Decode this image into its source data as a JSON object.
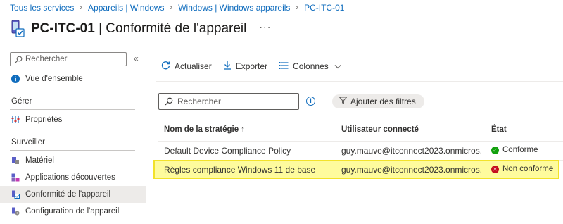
{
  "breadcrumb": [
    "Tous les services",
    "Appareils | Windows",
    "Windows | Windows appareils",
    "PC-ITC-01"
  ],
  "header": {
    "device": "PC-ITC-01",
    "separator": "|",
    "subtitle": "Conformité de l'appareil",
    "more": "···"
  },
  "sidebar": {
    "search_placeholder": "Rechercher",
    "collapse": "«",
    "overview": "Vue d'ensemble",
    "section_manage": "Gérer",
    "properties": "Propriétés",
    "section_monitor": "Surveiller",
    "items": [
      "Matériel",
      "Applications découvertes",
      "Conformité de l'appareil",
      "Configuration de l'appareil"
    ]
  },
  "toolbar": {
    "refresh": "Actualiser",
    "export": "Exporter",
    "columns": "Colonnes"
  },
  "filters": {
    "search_placeholder": "Rechercher",
    "add_filters": "Ajouter des filtres"
  },
  "table": {
    "headers": [
      "Nom de la stratégie ↑",
      "Utilisateur connecté",
      "État"
    ],
    "rows": [
      {
        "policy": "Default Device Compliance Policy",
        "user": "guy.mauve@itconnect2023.onmicros...",
        "state": "Conforme"
      },
      {
        "policy": "Règles compliance Windows 11 de base",
        "user": "guy.mauve@itconnect2023.onmicros...",
        "state": "Non conforme"
      }
    ]
  },
  "colors": {
    "accent": "#0f6cbd",
    "ok": "#13a10e",
    "error": "#c50f1f",
    "highlight": "#fefb9d"
  }
}
